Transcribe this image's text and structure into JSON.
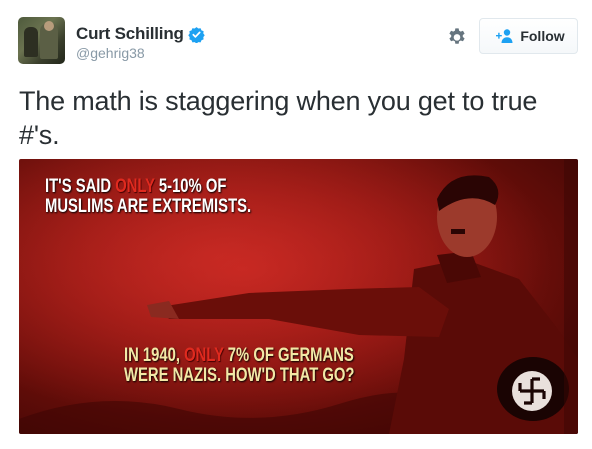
{
  "user": {
    "display_name": "Curt Schilling",
    "handle": "@gehrig38",
    "verified": true
  },
  "actions": {
    "settings_icon": "gear-icon",
    "follow_label": "Follow",
    "follow_icon": "add-user-icon"
  },
  "tweet": {
    "text_line1": "The math is staggering when you get to true",
    "text_line2": "#'s."
  },
  "media": {
    "top_caption": {
      "line1_a": "IT'S SAID ",
      "line1_hl": "ONLY",
      "line1_b": " 5-10% OF",
      "line2": "MUSLIMS ARE EXTREMISTS."
    },
    "bottom_caption": {
      "line1_a": "IN 1940, ",
      "line1_hl": "ONLY",
      "line1_b": " 7% OF GERMANS",
      "line2": "WERE NAZIS. HOW'D THAT GO?"
    }
  },
  "colors": {
    "text": "#292f33",
    "secondary": "#8899a6",
    "verified_blue": "#1da1f2",
    "highlight_red": "#e02a1f"
  }
}
